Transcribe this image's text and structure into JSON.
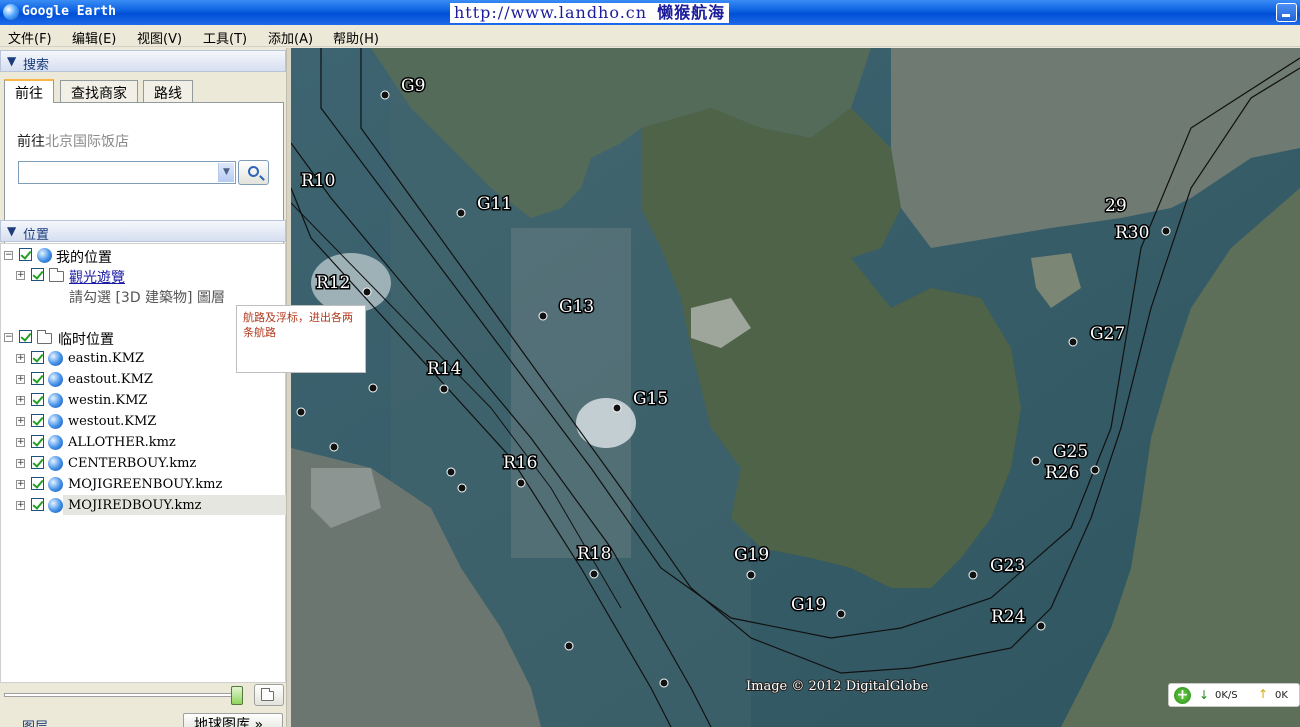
{
  "window": {
    "title": "Google Earth",
    "watermark_url": "http://www.landho.cn",
    "watermark_text": "懒猴航海"
  },
  "menu": [
    "文件(F)",
    "编辑(E)",
    "视图(V)",
    "工具(T)",
    "添加(A)",
    "帮助(H)"
  ],
  "search": {
    "header": "搜索",
    "tabs": [
      "前往",
      "查找商家",
      "路线"
    ],
    "goto_prefix": "前往",
    "goto_hint": "北京国际饭店",
    "input_value": ""
  },
  "places": {
    "header": "位置",
    "my_places": "我的位置",
    "tour_folder": "觀光遊覽",
    "tour_hint": "請勾選 [3D 建築物] 圖層",
    "temp_places": "临时位置",
    "files": [
      "eastin.KMZ",
      "eastout.KMZ",
      "westin.KMZ",
      "westout.KMZ",
      "ALLOTHER.kmz",
      "CENTERBOUY.kmz",
      "MOJIGREENBOUY.kmz",
      "MOJIREDBOUY.kmz"
    ],
    "popup_note": "航路及浮标，进出各两条航路"
  },
  "bottom": {
    "layers_label": "图层",
    "gallery_label": "地球图库 »"
  },
  "map": {
    "markers": [
      {
        "label": "G9"
      },
      {
        "label": "R10"
      },
      {
        "label": "G11"
      },
      {
        "label": "R12"
      },
      {
        "label": "G13"
      },
      {
        "label": "R14"
      },
      {
        "label": "G15"
      },
      {
        "label": "R16"
      },
      {
        "label": "R18"
      },
      {
        "label": "G19"
      },
      {
        "label": "G19"
      },
      {
        "label": "G23"
      },
      {
        "label": "R24"
      },
      {
        "label": "G25"
      },
      {
        "label": "R26"
      },
      {
        "label": "G27"
      },
      {
        "label": "29"
      },
      {
        "label": "R30"
      }
    ],
    "attribution": "Image © 2012 DigitalGlobe",
    "down_rate": "0K/S",
    "up_rate": "0K"
  }
}
